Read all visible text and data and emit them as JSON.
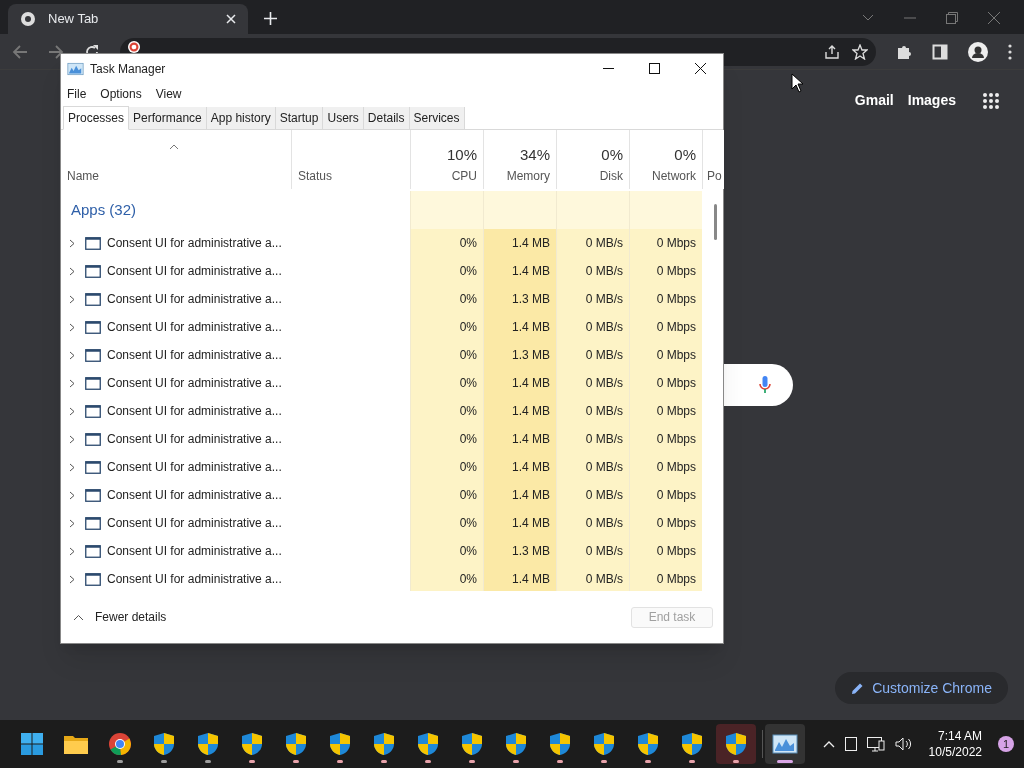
{
  "browser": {
    "tab_title": "New Tab",
    "links": [
      "Gmail",
      "Images"
    ],
    "customize": "Customize Chrome"
  },
  "task_manager": {
    "title": "Task Manager",
    "menu": [
      "File",
      "Options",
      "View"
    ],
    "tabs": [
      {
        "label": "Processes",
        "selected": true
      },
      {
        "label": "Performance",
        "selected": false
      },
      {
        "label": "App history",
        "selected": false
      },
      {
        "label": "Startup",
        "selected": false
      },
      {
        "label": "Users",
        "selected": false
      },
      {
        "label": "Details",
        "selected": false
      },
      {
        "label": "Services",
        "selected": false
      }
    ],
    "columns": [
      {
        "kind": "text",
        "name": "Name"
      },
      {
        "kind": "text",
        "name": "Status"
      },
      {
        "kind": "metric",
        "percent": "10%",
        "name": "CPU"
      },
      {
        "kind": "metric",
        "percent": "34%",
        "name": "Memory"
      },
      {
        "kind": "metric",
        "percent": "0%",
        "name": "Disk"
      },
      {
        "kind": "metric",
        "percent": "0%",
        "name": "Network"
      },
      {
        "kind": "cut",
        "name": "Po"
      }
    ],
    "group": "Apps (32)",
    "rows": [
      {
        "name": "Consent UI for administrative a...",
        "cpu": "0%",
        "memory": "1.4 MB",
        "disk": "0 MB/s",
        "network": "0 Mbps"
      },
      {
        "name": "Consent UI for administrative a...",
        "cpu": "0%",
        "memory": "1.4 MB",
        "disk": "0 MB/s",
        "network": "0 Mbps"
      },
      {
        "name": "Consent UI for administrative a...",
        "cpu": "0%",
        "memory": "1.3 MB",
        "disk": "0 MB/s",
        "network": "0 Mbps"
      },
      {
        "name": "Consent UI for administrative a...",
        "cpu": "0%",
        "memory": "1.4 MB",
        "disk": "0 MB/s",
        "network": "0 Mbps"
      },
      {
        "name": "Consent UI for administrative a...",
        "cpu": "0%",
        "memory": "1.3 MB",
        "disk": "0 MB/s",
        "network": "0 Mbps"
      },
      {
        "name": "Consent UI for administrative a...",
        "cpu": "0%",
        "memory": "1.4 MB",
        "disk": "0 MB/s",
        "network": "0 Mbps"
      },
      {
        "name": "Consent UI for administrative a...",
        "cpu": "0%",
        "memory": "1.4 MB",
        "disk": "0 MB/s",
        "network": "0 Mbps"
      },
      {
        "name": "Consent UI for administrative a...",
        "cpu": "0%",
        "memory": "1.4 MB",
        "disk": "0 MB/s",
        "network": "0 Mbps"
      },
      {
        "name": "Consent UI for administrative a...",
        "cpu": "0%",
        "memory": "1.4 MB",
        "disk": "0 MB/s",
        "network": "0 Mbps"
      },
      {
        "name": "Consent UI for administrative a...",
        "cpu": "0%",
        "memory": "1.4 MB",
        "disk": "0 MB/s",
        "network": "0 Mbps"
      },
      {
        "name": "Consent UI for administrative a...",
        "cpu": "0%",
        "memory": "1.4 MB",
        "disk": "0 MB/s",
        "network": "0 Mbps"
      },
      {
        "name": "Consent UI for administrative a...",
        "cpu": "0%",
        "memory": "1.3 MB",
        "disk": "0 MB/s",
        "network": "0 Mbps"
      },
      {
        "name": "Consent UI for administrative a...",
        "cpu": "0%",
        "memory": "1.4 MB",
        "disk": "0 MB/s",
        "network": "0 Mbps"
      }
    ],
    "footer": {
      "toggle": "Fewer details",
      "end_task": "End task",
      "end_task_disabled": true
    }
  },
  "taskbar": {
    "apps": [
      {
        "kind": "start",
        "selected": false
      },
      {
        "kind": "folder",
        "selected": false
      },
      {
        "kind": "chrome",
        "selected": false,
        "color": "#9e9e9e"
      },
      {
        "kind": "shield",
        "selected": false,
        "color": "#9e9e9e"
      },
      {
        "kind": "shield",
        "selected": false,
        "color": "#9e9e9e"
      },
      {
        "kind": "shield",
        "selected": false,
        "color": "#e8a3ab"
      },
      {
        "kind": "shield",
        "selected": false,
        "color": "#e8a3ab"
      },
      {
        "kind": "shield",
        "selected": false,
        "color": "#e8a3ab"
      },
      {
        "kind": "shield",
        "selected": false,
        "color": "#e8a3ab"
      },
      {
        "kind": "shield",
        "selected": false,
        "color": "#e8a3ab"
      },
      {
        "kind": "shield",
        "selected": false,
        "color": "#e8a3ab"
      },
      {
        "kind": "shield",
        "selected": false,
        "color": "#e8a3ab"
      },
      {
        "kind": "shield",
        "selected": false,
        "color": "#e8a3ab"
      },
      {
        "kind": "shield",
        "selected": false,
        "color": "#e8a3ab"
      },
      {
        "kind": "shield",
        "selected": false,
        "color": "#e8a3ab"
      },
      {
        "kind": "shield",
        "selected": false,
        "color": "#e8a3ab"
      },
      {
        "kind": "shield",
        "selected": true,
        "color": "#e8a3ab"
      },
      {
        "kind": "monitor",
        "selected": true,
        "color": "#d9a6e6"
      }
    ],
    "time": "7:14 AM",
    "date": "10/5/2022",
    "notifications": "1"
  }
}
